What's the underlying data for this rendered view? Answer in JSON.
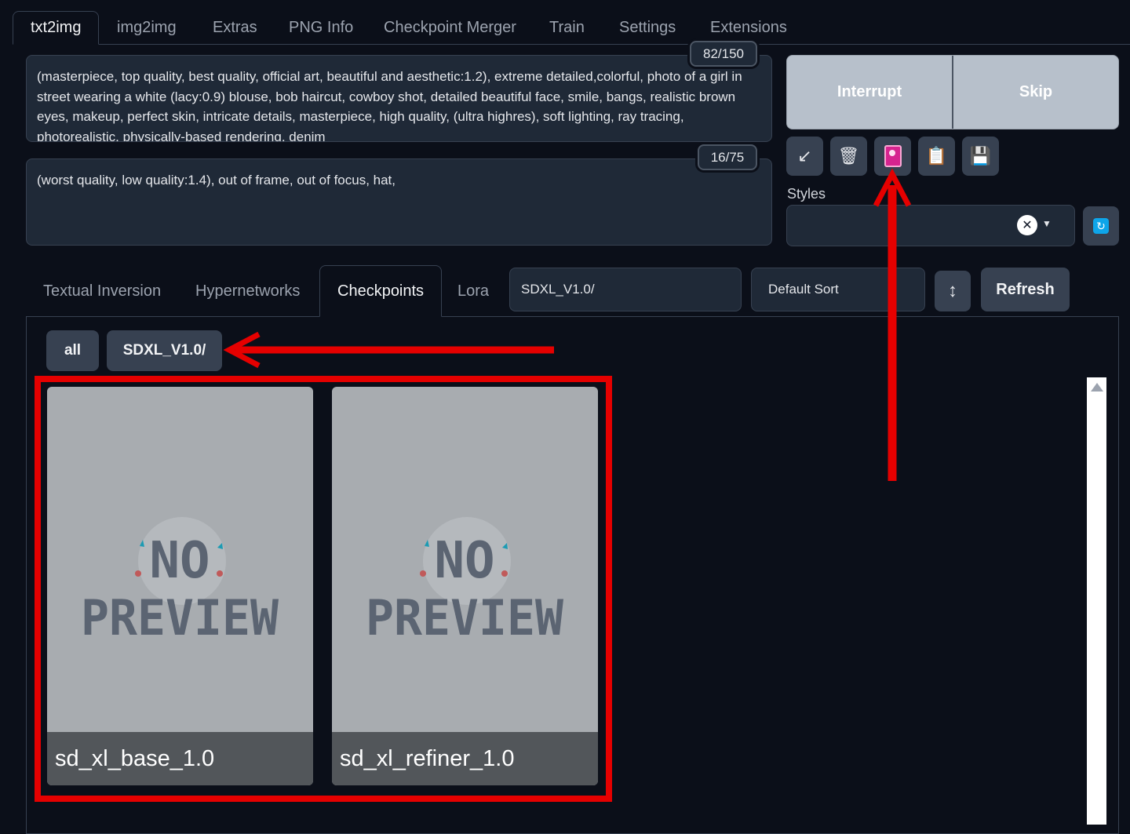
{
  "top_tabs": [
    "txt2img",
    "img2img",
    "Extras",
    "PNG Info",
    "Checkpoint Merger",
    "Train",
    "Settings",
    "Extensions"
  ],
  "prompt": {
    "text": "(masterpiece, top quality, best quality, official art, beautiful and aesthetic:1.2), extreme detailed,colorful, photo of a girl in street wearing a white (lacy:0.9) blouse, bob haircut, cowboy shot, detailed beautiful face, smile, bangs, realistic brown eyes, makeup, perfect skin, intricate details, masterpiece, high quality, (ultra highres), soft lighting, ray tracing, photorealistic, physically-based rendering, denim",
    "counter": "82/150"
  },
  "negative_prompt": {
    "text": "(worst quality, low quality:1.4), out of frame, out of focus, hat,",
    "counter": "16/75"
  },
  "actions": {
    "interrupt": "Interrupt",
    "skip": "Skip"
  },
  "tools": [
    {
      "icon": "arrow-icon",
      "glyph": "↙"
    },
    {
      "icon": "trash-icon",
      "glyph": "🗑"
    },
    {
      "icon": "extra-networks-icon",
      "glyph": "🎴"
    },
    {
      "icon": "clipboard-icon",
      "glyph": "📋"
    },
    {
      "icon": "save-icon",
      "glyph": "💾"
    }
  ],
  "styles": {
    "label": "Styles",
    "clear_glyph": "✕",
    "caret": "▼",
    "refresh_glyph": "↻"
  },
  "network_tabs": [
    "Textual Inversion",
    "Hypernetworks",
    "Checkpoints",
    "Lora"
  ],
  "search": {
    "value": "SDXL_V1.0/"
  },
  "sort": {
    "value": "Default Sort",
    "direction_glyph": "↕"
  },
  "refresh": "Refresh",
  "folders": [
    "all",
    "SDXL_V1.0/"
  ],
  "cards": [
    {
      "name": "sd_xl_base_1.0",
      "preview_line1": "NO",
      "preview_line2": "PREVIEW"
    },
    {
      "name": "sd_xl_refiner_1.0",
      "preview_line1": "NO",
      "preview_line2": "PREVIEW"
    }
  ],
  "colors": {
    "background": "#0b0f19",
    "panel": "#1f2937",
    "annotation": "#e50000",
    "interrupt_bg": "#b7c0cb"
  }
}
